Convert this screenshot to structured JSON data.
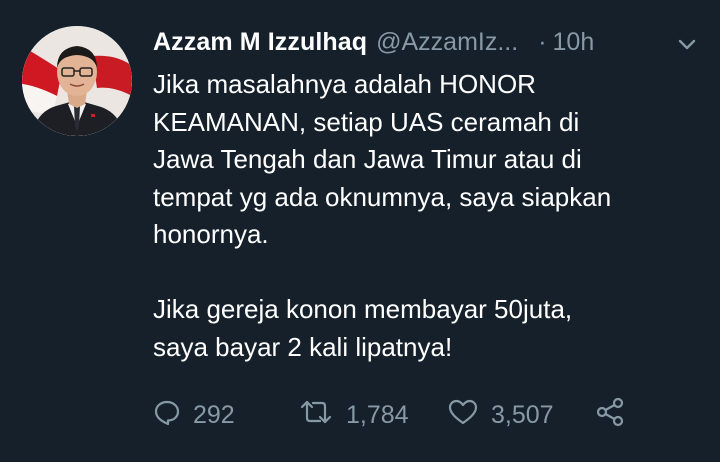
{
  "tweet": {
    "author": {
      "display_name": "Azzam M Izzulhaq",
      "handle": "@AzzamIz...",
      "avatar": "profile-photo"
    },
    "separator": "·",
    "time": "10h",
    "body_lines": [
      "Jika masalahnya adalah HONOR",
      "KEAMANAN, setiap UAS ceramah di",
      "Jawa Tengah dan Jawa Timur atau di",
      "tempat yg ada oknumnya, saya siapkan",
      "honornya.",
      "",
      "Jika gereja konon membayar 50juta,",
      "saya bayar 2 kali lipatnya!"
    ],
    "actions": {
      "reply": {
        "icon": "reply-icon",
        "count": "292"
      },
      "retweet": {
        "icon": "retweet-icon",
        "count": "1,784"
      },
      "like": {
        "icon": "heart-icon",
        "count": "3,507"
      },
      "share": {
        "icon": "share-icon"
      }
    },
    "menu_icon": "chevron-down-icon"
  },
  "colors": {
    "background": "#15202b",
    "text_primary": "#ffffff",
    "text_secondary": "#8899a6"
  }
}
